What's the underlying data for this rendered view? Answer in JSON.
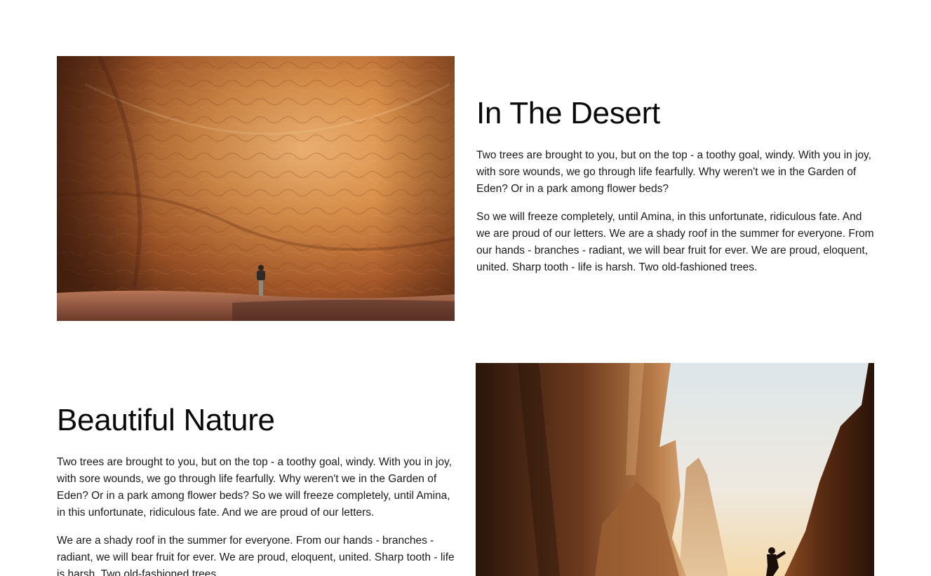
{
  "sections": [
    {
      "heading": "In The Desert",
      "image_alt": "Person standing before a massive orange sandstone cliff in the desert",
      "paragraphs": [
        "Two trees are brought to you, but on the top - a toothy goal, windy. With you in joy, with sore wounds, we go through life fearfully. Why weren't we in the Garden of Eden? Or in a park among flower beds?",
        "So we will freeze completely, until Amina, in this unfortunate, ridiculous fate. And we are proud of our letters. We are a shady roof in the summer for everyone. From our hands - branches - radiant, we will bear fruit for ever. We are proud, eloquent, united. Sharp tooth - life is harsh. Two old-fashioned trees."
      ]
    },
    {
      "heading": "Beautiful Nature",
      "image_alt": "Climber silhouetted between towering canyon rock walls",
      "paragraphs": [
        "Two trees are brought to you, but on the top - a toothy goal, windy. With you in joy, with sore wounds, we go through life fearfully. Why weren't we in the Garden of Eden? Or in a park among flower beds? So we will freeze completely, until Amina, in this unfortunate, ridiculous fate. And we are proud of our letters.",
        "We are a shady roof in the summer for everyone. From our hands - branches - radiant, we will bear fruit for ever. We are proud, eloquent, united. Sharp tooth - life is harsh. Two old-fashioned trees."
      ]
    }
  ],
  "colors": {
    "background": "#ffffff",
    "text": "#1a1a1a",
    "heading": "#0a0a0a",
    "desert_rock": "#c9823f",
    "canyon_sky": "#e9eef0"
  }
}
